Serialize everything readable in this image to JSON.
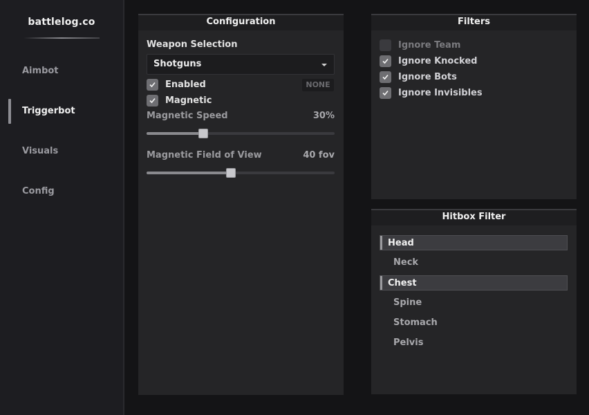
{
  "app": {
    "logo": "battlelog.co"
  },
  "sidebar": {
    "items": [
      {
        "label": "Aimbot",
        "active": false
      },
      {
        "label": "Triggerbot",
        "active": true
      },
      {
        "label": "Visuals",
        "active": false
      },
      {
        "label": "Config",
        "active": false
      }
    ]
  },
  "configuration": {
    "title": "Configuration",
    "weapon_selection_label": "Weapon Selection",
    "weapon_selected": "Shotguns",
    "enabled_label": "Enabled",
    "enabled_checked": true,
    "keybind": "NONE",
    "magnetic_label": "Magnetic",
    "magnetic_checked": true,
    "magnetic_speed_label": "Magnetic Speed",
    "magnetic_speed_value": "30%",
    "magnetic_speed_fraction": 0.3,
    "magnetic_fov_label": "Magnetic Field of View",
    "magnetic_fov_value": "40 fov",
    "magnetic_fov_fraction": 0.45
  },
  "filters": {
    "title": "Filters",
    "items": [
      {
        "label": "Ignore Team",
        "checked": false
      },
      {
        "label": "Ignore Knocked",
        "checked": true
      },
      {
        "label": "Ignore Bots",
        "checked": true
      },
      {
        "label": "Ignore Invisibles",
        "checked": true
      }
    ]
  },
  "hitbox_filter": {
    "title": "Hitbox Filter",
    "items": [
      {
        "label": "Head",
        "selected": true
      },
      {
        "label": "Neck",
        "selected": false
      },
      {
        "label": "Chest",
        "selected": true
      },
      {
        "label": "Spine",
        "selected": false
      },
      {
        "label": "Stomach",
        "selected": false
      },
      {
        "label": "Pelvis",
        "selected": false
      }
    ]
  },
  "colors": {
    "background": "#141416",
    "sidebar": "#1d1d21",
    "panel": "#252527",
    "checkbox_checked": "#6e6e72",
    "accent": "#8e8e94"
  }
}
